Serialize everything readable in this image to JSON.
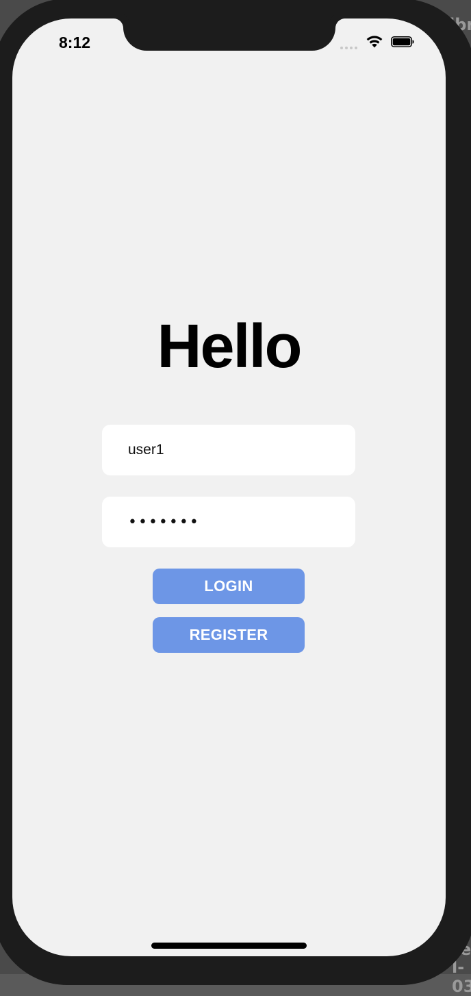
{
  "status_bar": {
    "time": "8:12"
  },
  "login_screen": {
    "heading": "Hello",
    "username_value": "user1",
    "password_value": "•••••••",
    "login_label": "LOGIN",
    "register_label": "REGISTER"
  },
  "background": {
    "edge_text_top": "ibr",
    "edge_text_bottom_1": "ed",
    "edge_text_bottom_2": "l-03"
  },
  "colors": {
    "button_accent": "#6d96e6",
    "screen_background": "#f1f1f1",
    "device_frame": "#1c1c1c",
    "field_background": "#ffffff"
  },
  "icons": {
    "signal": "cellular-signal-icon",
    "wifi": "wifi-icon",
    "battery": "battery-icon"
  }
}
